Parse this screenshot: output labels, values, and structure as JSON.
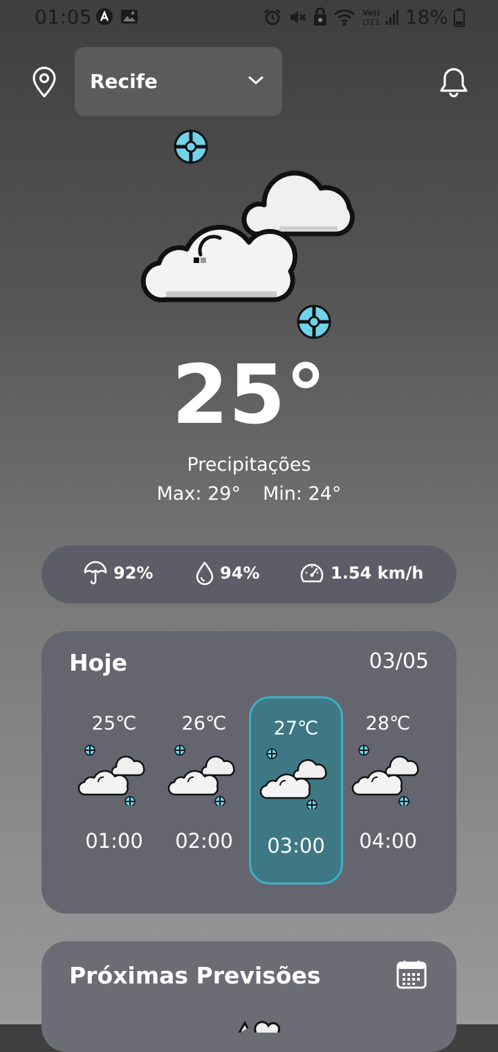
{
  "status_bar": {
    "time": "01:05",
    "battery": "18%",
    "left_icons": [
      "notification-a-icon",
      "gallery-icon"
    ],
    "right_icons": [
      "alarm-icon",
      "mute-icon",
      "vpn-icon",
      "wifi-icon",
      "volte-signal-icon",
      "battery-icon"
    ]
  },
  "header": {
    "city": "Recife",
    "location_icon": "location-pin-icon",
    "dropdown_icon": "chevron-down-icon",
    "notification_icon": "bell-icon"
  },
  "current": {
    "temperature": "25°",
    "condition": "Precipitações",
    "max": "Max: 29°",
    "min": "Min: 24°",
    "icon": "cloudy-rain-icon"
  },
  "stats": {
    "rain": "92%",
    "humidity": "94%",
    "wind": "1.54 km/h"
  },
  "today": {
    "title": "Hoje",
    "date": "03/05",
    "hours": [
      {
        "temp": "25℃",
        "time": "01:00",
        "active": false
      },
      {
        "temp": "26℃",
        "time": "02:00",
        "active": false
      },
      {
        "temp": "27℃",
        "time": "03:00",
        "active": true
      },
      {
        "temp": "28℃",
        "time": "04:00",
        "active": false
      }
    ]
  },
  "next": {
    "title": "Próximas Previsões",
    "calendar_icon": "calendar-icon"
  },
  "colors": {
    "accent": "#3ab1c8",
    "card": "#65656f",
    "stats_bar": "#5d5d67"
  }
}
